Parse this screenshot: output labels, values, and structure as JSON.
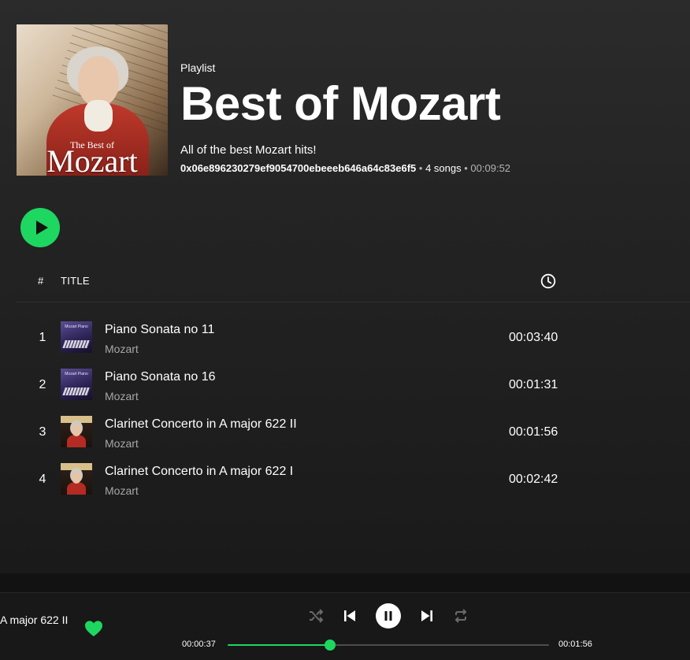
{
  "colors": {
    "accent": "#1ed760",
    "background": "#121212",
    "muted_text": "#a7a7a7"
  },
  "playlist": {
    "type_label": "Playlist",
    "title": "Best of Mozart",
    "description": "All of the best Mozart hits!",
    "owner": "0x06e896230279ef9054700ebeeeb646a64c83e6f5",
    "song_count": "4 songs",
    "total_duration": "00:09:52",
    "cover": {
      "subtitle": "The Best of",
      "title": "Mozart"
    }
  },
  "table_header": {
    "number": "#",
    "title": "TITLE",
    "duration_icon": "clock-icon"
  },
  "tracks": [
    {
      "number": "1",
      "title": "Piano Sonata no 11",
      "artist": "Mozart",
      "duration": "00:03:40",
      "thumb": "piano",
      "thumb_caption": "Mozart Piano"
    },
    {
      "number": "2",
      "title": "Piano Sonata no 16",
      "artist": "Mozart",
      "duration": "00:01:31",
      "thumb": "piano",
      "thumb_caption": "Mozart Piano"
    },
    {
      "number": "3",
      "title": "Clarinet Concerto in A major 622 II",
      "artist": "Mozart",
      "duration": "00:01:56",
      "thumb": "mozart"
    },
    {
      "number": "4",
      "title": "Clarinet Concerto in A major 622 I",
      "artist": "Mozart",
      "duration": "00:02:42",
      "thumb": "mozart"
    }
  ],
  "player": {
    "now_playing_title": "A major 622 II",
    "liked": true,
    "current_time": "00:00:37",
    "total_time": "00:01:56",
    "progress_fraction": 0.319,
    "controls": [
      "shuffle-icon",
      "previous-icon",
      "pause-icon",
      "next-icon",
      "repeat-icon"
    ]
  }
}
